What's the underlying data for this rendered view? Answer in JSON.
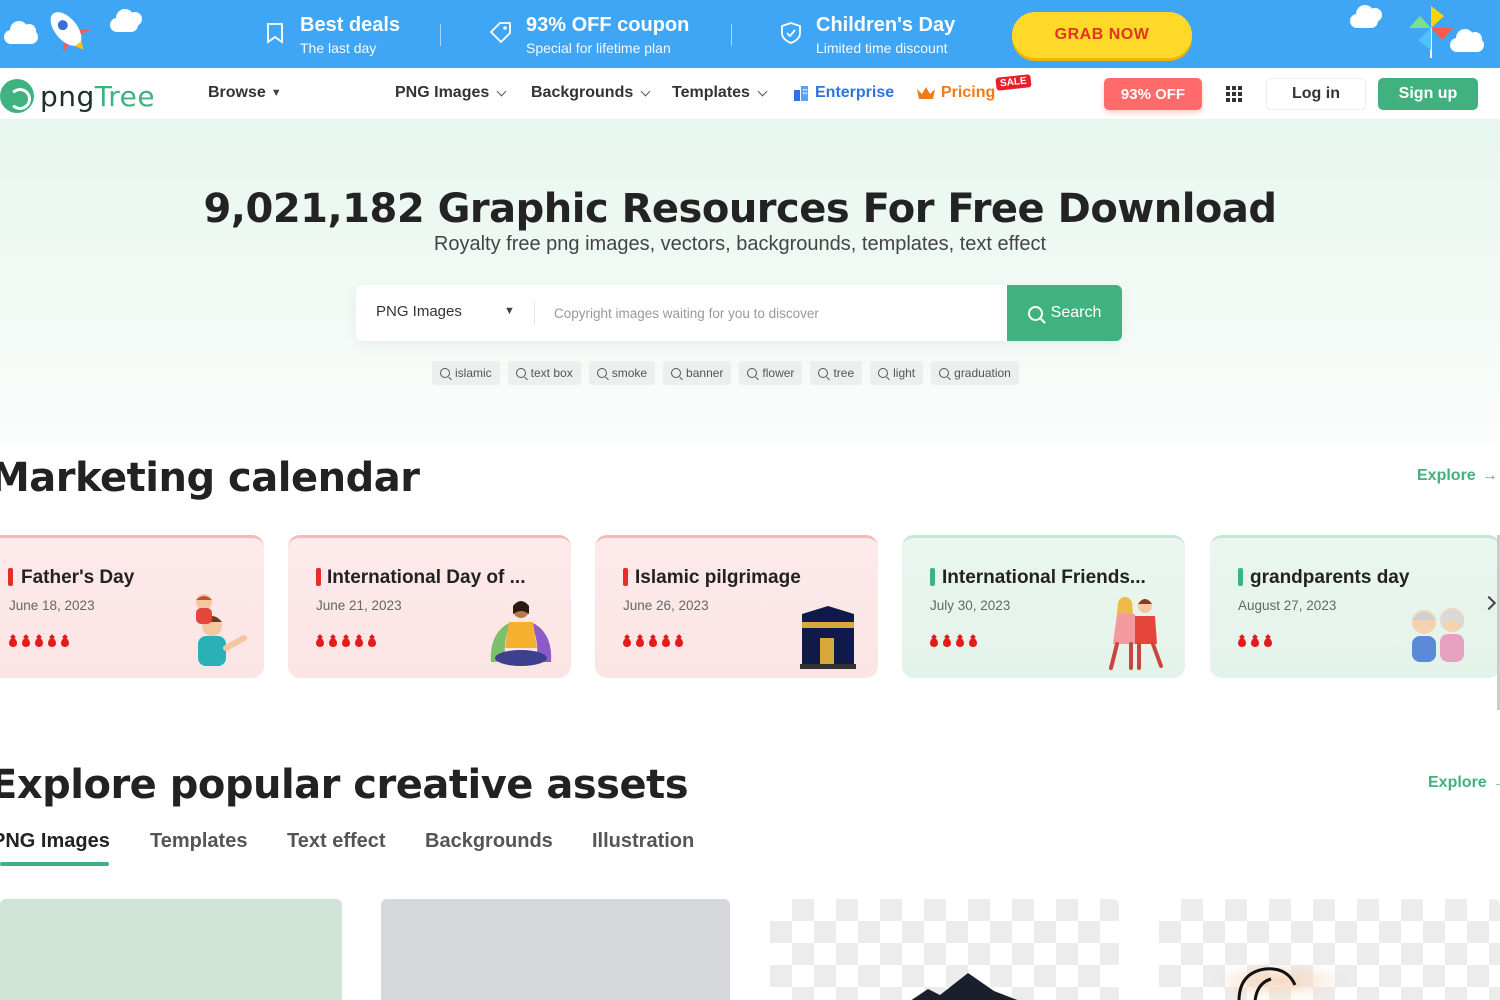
{
  "promo": {
    "items": [
      {
        "title": "Best deals",
        "subtitle": "The last day"
      },
      {
        "title": "93% OFF coupon",
        "subtitle": "Special for lifetime plan"
      },
      {
        "title": "Children's Day",
        "subtitle": "Limited time discount"
      }
    ],
    "cta": "GRAB NOW"
  },
  "nav": {
    "logo": {
      "part1": "png",
      "part2": "Tree"
    },
    "browse": "Browse",
    "png_images": "PNG Images",
    "backgrounds": "Backgrounds",
    "templates": "Templates",
    "enterprise": "Enterprise",
    "pricing": "Pricing",
    "sale_badge": "SALE",
    "off_button": "93% OFF",
    "login": "Log in",
    "signup": "Sign up"
  },
  "hero": {
    "title": "9,021,182 Graphic Resources For Free Download",
    "subtitle": "Royalty free png images, vectors, backgrounds, templates, text effect",
    "search": {
      "type": "PNG Images",
      "placeholder": "Copyright images waiting for you to discover",
      "button": "Search"
    },
    "tags": [
      "islamic",
      "text box",
      "smoke",
      "banner",
      "flower",
      "tree",
      "light",
      "graduation"
    ]
  },
  "calendar": {
    "title": "Marketing calendar",
    "explore": "Explore",
    "cards": [
      {
        "title": "Father's Day",
        "date": "June 18, 2023",
        "rating": 5,
        "theme": "pink",
        "art": "father-child-illustration"
      },
      {
        "title": "International Day of ...",
        "date": "June 21, 2023",
        "rating": 5,
        "theme": "pink",
        "art": "yoga-woman-illustration"
      },
      {
        "title": "Islamic pilgrimage",
        "date": "June 26, 2023",
        "rating": 5,
        "theme": "pink",
        "art": "kaaba-illustration"
      },
      {
        "title": "International Friends...",
        "date": "July 30, 2023",
        "rating": 4,
        "theme": "green",
        "art": "friends-illustration"
      },
      {
        "title": "grandparents day",
        "date": "August 27, 2023",
        "rating": 3,
        "theme": "green",
        "art": "grandparents-illustration"
      }
    ]
  },
  "assets": {
    "title": "Explore popular creative assets",
    "explore": "Explore",
    "tabs": [
      "PNG Images",
      "Templates",
      "Text effect",
      "Backgrounds",
      "Illustration"
    ],
    "active_tab": "PNG Images"
  },
  "colors": {
    "brand_green": "#3fb27f",
    "promo_blue": "#3fa5f5",
    "grab_yellow": "#ffd92a",
    "accent_red": "#e31b1b"
  }
}
